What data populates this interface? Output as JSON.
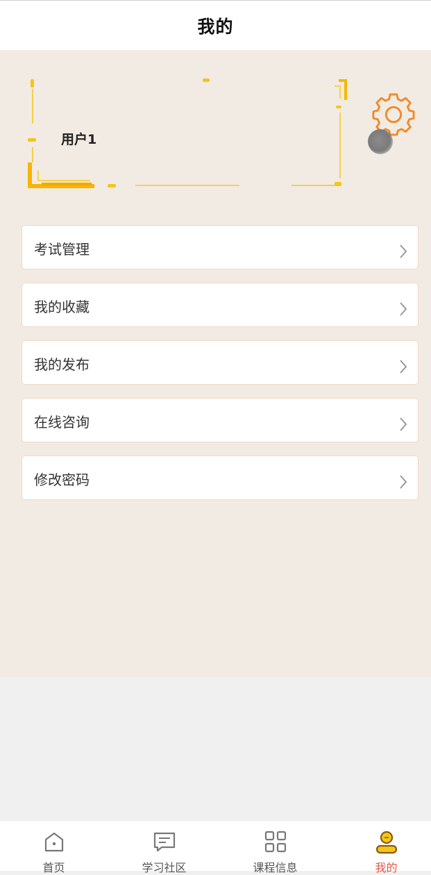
{
  "header": {
    "title": "我的"
  },
  "profile": {
    "username": "用户1"
  },
  "menu": {
    "items": [
      {
        "label": "考试管理"
      },
      {
        "label": "我的收藏"
      },
      {
        "label": "我的发布"
      },
      {
        "label": "在线咨询"
      },
      {
        "label": "修改密码"
      }
    ]
  },
  "tabbar": {
    "items": [
      {
        "label": "首页",
        "icon": "home-icon"
      },
      {
        "label": "学习社区",
        "icon": "message-icon"
      },
      {
        "label": "课程信息",
        "icon": "grid-icon"
      },
      {
        "label": "我的",
        "icon": "user-icon",
        "active": true
      }
    ]
  },
  "colors": {
    "accent": "#e0584a",
    "gold": "#f5c518",
    "settings": "#f08a2a",
    "background": "#f2ebe3"
  }
}
